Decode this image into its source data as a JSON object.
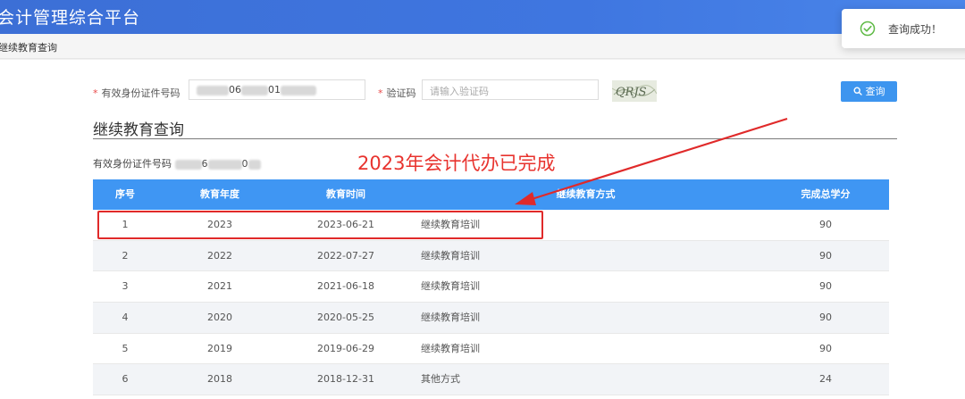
{
  "header": {
    "title": "会计管理综合平台"
  },
  "breadcrumb": {
    "text": "继续教育查询"
  },
  "toast": {
    "message": "查询成功！",
    "icon": "check-circle-icon",
    "color": "#5fba46"
  },
  "form": {
    "id_label": "有效身份证件号码",
    "id_value_visible": [
      "06",
      "01"
    ],
    "captcha_label": "验证码",
    "captcha_placeholder": "请输入验证码",
    "captcha_image_text": "QRJS",
    "query_button": "查询",
    "required_mark": "*"
  },
  "section": {
    "title": "继续教育查询",
    "id_line_label": "有效身份证件号码",
    "id_line_visible": [
      "6",
      "0"
    ]
  },
  "table": {
    "columns": [
      "序号",
      "教育年度",
      "教育时间",
      "继续教育方式",
      "完成总学分"
    ],
    "rows": [
      {
        "index": "1",
        "year": "2023",
        "date": "2023-06-21",
        "method": "继续教育培训",
        "credits": "90"
      },
      {
        "index": "2",
        "year": "2022",
        "date": "2022-07-27",
        "method": "继续教育培训",
        "credits": "90"
      },
      {
        "index": "3",
        "year": "2021",
        "date": "2021-06-18",
        "method": "继续教育培训",
        "credits": "90"
      },
      {
        "index": "4",
        "year": "2020",
        "date": "2020-05-25",
        "method": "继续教育培训",
        "credits": "90"
      },
      {
        "index": "5",
        "year": "2019",
        "date": "2019-06-29",
        "method": "继续教育培训",
        "credits": "90"
      },
      {
        "index": "6",
        "year": "2018",
        "date": "2018-12-31",
        "method": "其他方式",
        "credits": "24"
      }
    ]
  },
  "annotation": {
    "text": "2023年会计代办已完成",
    "color": "#e8332e"
  },
  "colors": {
    "header": "#3f76e0",
    "table_header": "#3f96f3",
    "button": "#3d95ef",
    "highlight": "#e02a2a"
  }
}
